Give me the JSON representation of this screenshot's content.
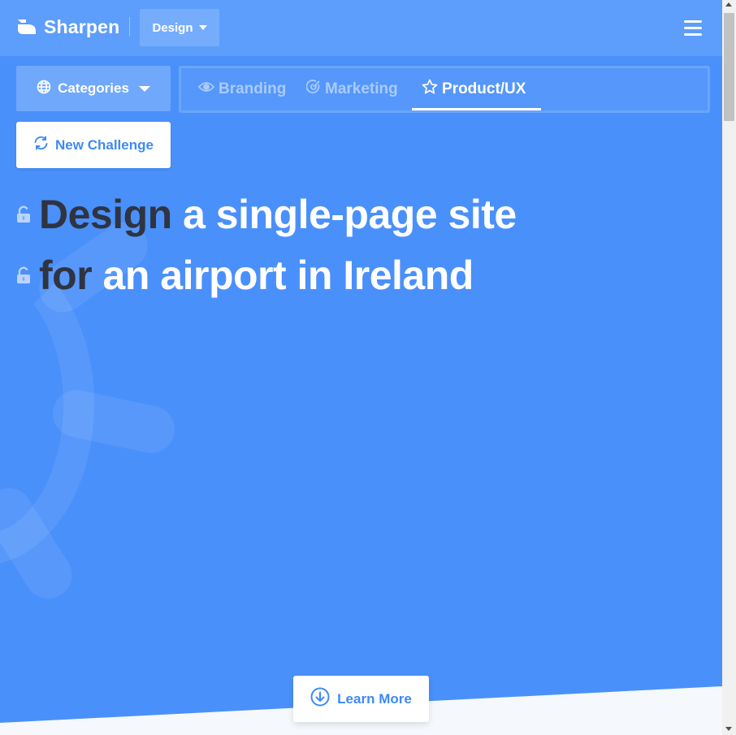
{
  "brand": {
    "name": "Sharpen"
  },
  "nav": {
    "dropdown_label": "Design",
    "menu_icon": "hamburger-menu-icon"
  },
  "categories": {
    "label": "Categories",
    "icon": "globe-icon"
  },
  "tabs": [
    {
      "label": "Branding",
      "icon": "eye-icon",
      "active": false
    },
    {
      "label": "Marketing",
      "icon": "target-icon",
      "active": false
    },
    {
      "label": "Product/UX",
      "icon": "star-icon",
      "active": true
    }
  ],
  "new_challenge": {
    "label": "New Challenge",
    "icon": "refresh-icon"
  },
  "challenge": {
    "line1": {
      "keyword": "Design",
      "rest": " a single-page site"
    },
    "line2": {
      "keyword": "for",
      "rest": " an airport in Ireland"
    }
  },
  "learn_more": {
    "label": "Learn More",
    "icon": "arrow-down-circle-icon"
  },
  "colors": {
    "background": "#4a90fb",
    "navbar": "#5d9dfc",
    "accent": "#3d8af5",
    "keyword": "#2f3440"
  }
}
